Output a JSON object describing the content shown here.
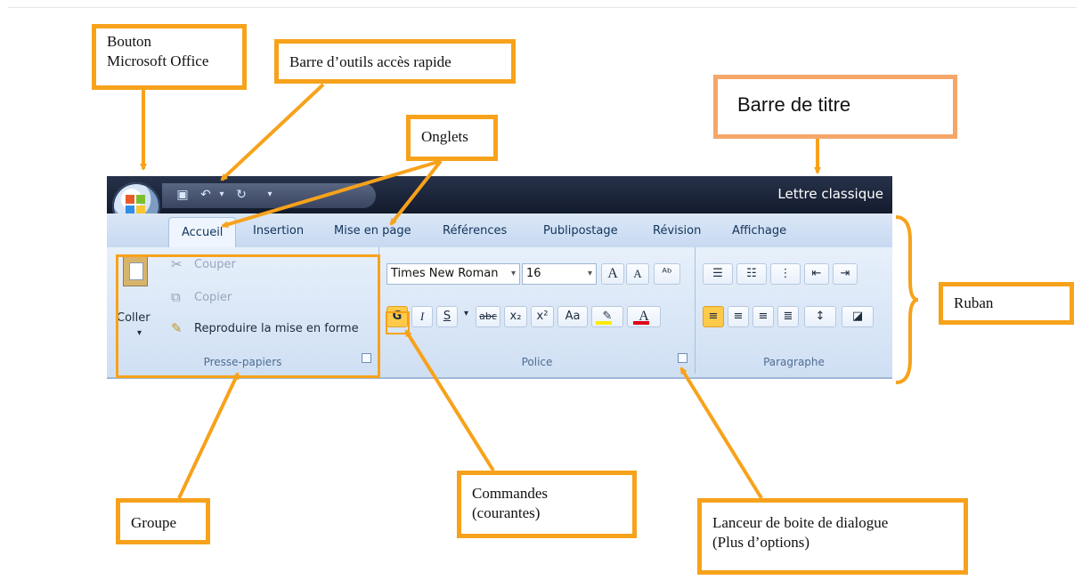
{
  "callouts": {
    "bouton_line1": "Bouton",
    "bouton_line2": "Microsoft Office",
    "qat": "Barre d’outils accès rapide",
    "title": "Barre de titre",
    "tabs": "Onglets",
    "ribbon": "Ruban",
    "group": "Groupe",
    "commands_line1": "Commandes",
    "commands_line2": "(courantes)",
    "launcher_line1": "Lanceur de boite de dialogue",
    "launcher_line2": "(Plus d’options)"
  },
  "ribbon": {
    "title_text": "Lettre classique",
    "tabs": [
      "Accueil",
      "Insertion",
      "Mise en page",
      "Références",
      "Publipostage",
      "Révision",
      "Affichage"
    ],
    "clipboard": {
      "paste": "Coller",
      "cut": "Couper",
      "copy": "Copier",
      "format_painter": "Reproduire la mise en forme",
      "label": "Presse-papiers"
    },
    "font": {
      "font_name": "Times New Roman",
      "font_size": "16",
      "grow": "A",
      "shrink": "A",
      "bold": "G",
      "italic": "I",
      "underline": "S",
      "strike": "abc",
      "subscript": "x₂",
      "superscript": "x²",
      "case": "Aa",
      "label": "Police"
    },
    "paragraph": {
      "label": "Paragraphe"
    }
  },
  "colors": {
    "accent_orange": "#f7a21b",
    "title_bar": "#1a2236",
    "ribbon_blue": "#dbe8f8"
  },
  "icons": {
    "office": "office-logo-icon",
    "save": "save-icon",
    "undo": "undo-icon",
    "redo": "redo-icon"
  }
}
